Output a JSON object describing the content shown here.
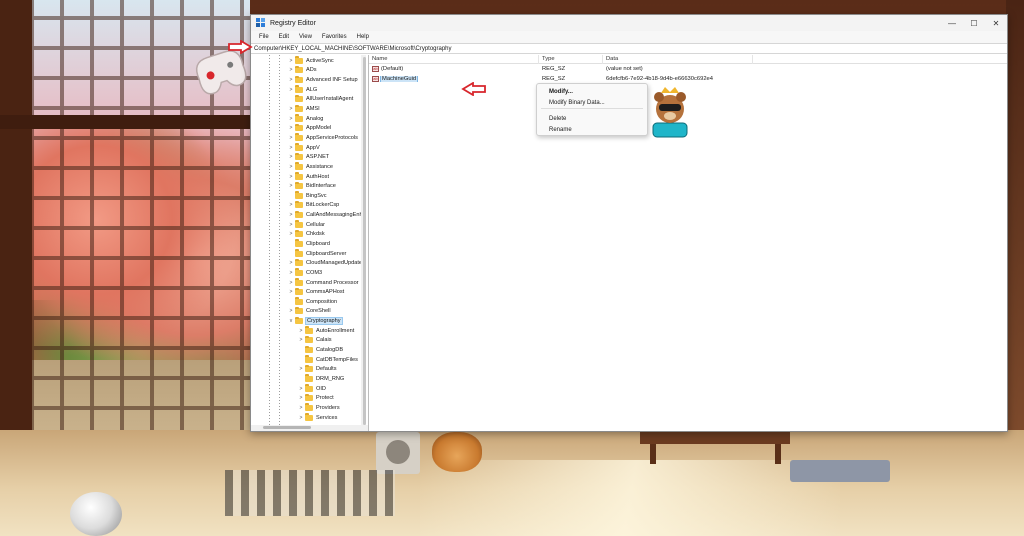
{
  "window": {
    "title": "Registry Editor",
    "controls": {
      "minimize": "—",
      "maximize": "☐",
      "close": "✕"
    },
    "menu": [
      "File",
      "Edit",
      "View",
      "Favorites",
      "Help"
    ],
    "address": "Computer\\HKEY_LOCAL_MACHINE\\SOFTWARE\\Microsoft\\Cryptography"
  },
  "tree": {
    "items": [
      {
        "label": "ActiveSync",
        "chevron": ">",
        "level": 1
      },
      {
        "label": "ADs",
        "chevron": ">",
        "level": 1
      },
      {
        "label": "Advanced INF Setup",
        "chevron": ">",
        "level": 1
      },
      {
        "label": "ALG",
        "chevron": ">",
        "level": 1
      },
      {
        "label": "AllUserInstallAgent",
        "chevron": "",
        "level": 1
      },
      {
        "label": "AMSI",
        "chevron": ">",
        "level": 1
      },
      {
        "label": "Analog",
        "chevron": ">",
        "level": 1
      },
      {
        "label": "AppModel",
        "chevron": ">",
        "level": 1
      },
      {
        "label": "AppServiceProtocols",
        "chevron": ">",
        "level": 1
      },
      {
        "label": "AppV",
        "chevron": ">",
        "level": 1
      },
      {
        "label": "ASP.NET",
        "chevron": ">",
        "level": 1
      },
      {
        "label": "Assistance",
        "chevron": ">",
        "level": 1
      },
      {
        "label": "AuthHost",
        "chevron": ">",
        "level": 1
      },
      {
        "label": "BidInterface",
        "chevron": ">",
        "level": 1
      },
      {
        "label": "BingSvc",
        "chevron": "",
        "level": 1
      },
      {
        "label": "BitLockerCsp",
        "chevron": ">",
        "level": 1
      },
      {
        "label": "CallAndMessagingEnhancement",
        "chevron": ">",
        "level": 1
      },
      {
        "label": "Cellular",
        "chevron": ">",
        "level": 1
      },
      {
        "label": "Chkdsk",
        "chevron": ">",
        "level": 1
      },
      {
        "label": "Clipboard",
        "chevron": "",
        "level": 1
      },
      {
        "label": "ClipboardServer",
        "chevron": "",
        "level": 1
      },
      {
        "label": "CloudManagedUpdate",
        "chevron": ">",
        "level": 1
      },
      {
        "label": "COM3",
        "chevron": ">",
        "level": 1
      },
      {
        "label": "Command Processor",
        "chevron": ">",
        "level": 1
      },
      {
        "label": "CommsAPHost",
        "chevron": ">",
        "level": 1
      },
      {
        "label": "Composition",
        "chevron": "",
        "level": 1
      },
      {
        "label": "CoreShell",
        "chevron": ">",
        "level": 1
      },
      {
        "label": "Cryptography",
        "chevron": "v",
        "level": 1,
        "selected": true
      },
      {
        "label": "AutoEnrollment",
        "chevron": ">",
        "level": 2
      },
      {
        "label": "Calais",
        "chevron": ">",
        "level": 2
      },
      {
        "label": "CatalogDB",
        "chevron": "",
        "level": 2
      },
      {
        "label": "CatDBTempFiles",
        "chevron": "",
        "level": 2
      },
      {
        "label": "Defaults",
        "chevron": ">",
        "level": 2
      },
      {
        "label": "DRM_RNG",
        "chevron": "",
        "level": 2
      },
      {
        "label": "OID",
        "chevron": ">",
        "level": 2
      },
      {
        "label": "Protect",
        "chevron": ">",
        "level": 2
      },
      {
        "label": "Providers",
        "chevron": ">",
        "level": 2
      },
      {
        "label": "Services",
        "chevron": ">",
        "level": 2
      }
    ]
  },
  "values_pane": {
    "headers": {
      "name": "Name",
      "type": "Type",
      "data": "Data"
    },
    "rows": [
      {
        "icon": "ab",
        "name": "(Default)",
        "type": "REG_SZ",
        "data": "(value not set)"
      },
      {
        "icon": "ab",
        "name": "MachineGuid",
        "type": "REG_SZ",
        "data": "6defcfb6-7e92-4b18-9d4b-e66630c692e4",
        "selected": true
      }
    ]
  },
  "context_menu": {
    "items": [
      "Modify...",
      "Modify Binary Data...",
      "Delete",
      "Rename"
    ]
  },
  "colors": {
    "accent_arrow": "#d8262c",
    "selection": "#cce4f7",
    "folder": "#f5c542"
  }
}
